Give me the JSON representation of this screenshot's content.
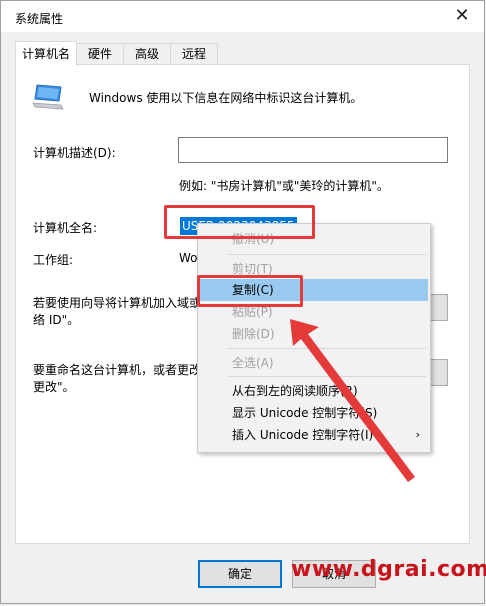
{
  "window": {
    "title": "系统属性",
    "close_glyph": "✕"
  },
  "tabs": [
    {
      "label": "计算机名",
      "active": true
    },
    {
      "label": "硬件",
      "active": false
    },
    {
      "label": "高级",
      "active": false
    },
    {
      "label": "远程",
      "active": false
    }
  ],
  "panel": {
    "intro": "Windows 使用以下信息在网络中标识这台计算机。",
    "description_label": "计算机描述(D):",
    "description_value": "",
    "example": "例如: \"书房计算机\"或\"美玲的计算机\"。",
    "fullname_label": "计算机全名:",
    "fullname_value": "USER-2023043855",
    "workgroup_label": "工作组:",
    "workgroup_value": "Wo",
    "network_text_1": "若要使用向导将计算机加入域或",
    "network_text_2": "络 ID\"。",
    "rename_text_1": "要重命名这台计算机，或者更改",
    "rename_text_2": "更改\"。"
  },
  "context_menu": {
    "items": [
      {
        "label": "撤消(U)",
        "enabled": false,
        "highlighted": false
      },
      {
        "label": "剪切(T)",
        "enabled": false,
        "highlighted": false
      },
      {
        "label": "复制(C)",
        "enabled": true,
        "highlighted": true
      },
      {
        "label": "粘贴(P)",
        "enabled": false,
        "highlighted": false
      },
      {
        "label": "删除(D)",
        "enabled": false,
        "highlighted": false
      },
      {
        "label": "全选(A)",
        "enabled": false,
        "highlighted": false
      },
      {
        "label": "从右到左的阅读顺序(R)",
        "enabled": true,
        "highlighted": false
      },
      {
        "label": "显示 Unicode 控制字符(S)",
        "enabled": true,
        "highlighted": false
      },
      {
        "label": "插入 Unicode 控制字符(I)",
        "enabled": true,
        "highlighted": false
      }
    ],
    "submenu_arrow": "›"
  },
  "buttons": {
    "ok": "确定",
    "cancel": "取消"
  },
  "watermark": "www.dgrai.com",
  "colors": {
    "annotation_red": "#e53a3a",
    "selection_blue": "#0078d7",
    "menu_highlight": "#99c9ef",
    "watermark_red": "#c8141a"
  }
}
